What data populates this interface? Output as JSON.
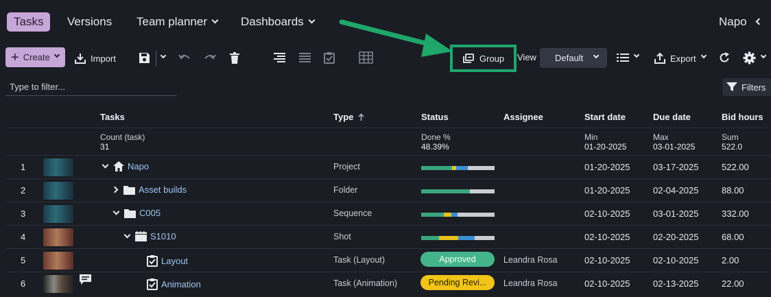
{
  "nav": {
    "tabs": [
      {
        "label": "Tasks"
      },
      {
        "label": "Versions"
      },
      {
        "label": "Team planner"
      },
      {
        "label": "Dashboards"
      }
    ],
    "project": "Napo"
  },
  "toolbar": {
    "create_label": "Create",
    "import_label": "Import",
    "group_label": "Group",
    "view_label": "View",
    "view_value": "Default",
    "export_label": "Export"
  },
  "filter": {
    "placeholder": "Type to filter...",
    "filters_label": "Filters"
  },
  "table": {
    "headers": {
      "tasks": "Tasks",
      "type": "Type",
      "status": "Status",
      "assignee": "Assignee",
      "start": "Start date",
      "due": "Due date",
      "bid": "Bid hours"
    },
    "aggregates": {
      "tasks_label": "Count (task)",
      "tasks_value": "31",
      "status_label": "Done %",
      "status_value": "48.39%",
      "start_label": "Min",
      "start_value": "01-20-2025",
      "due_label": "Max",
      "due_value": "03-01-2025",
      "bid_label": "Sum",
      "bid_value": "522.0"
    },
    "rows": [
      {
        "num": "1",
        "name": "Napo",
        "type": "Project",
        "start": "01-20-2025",
        "due": "03-17-2025",
        "bid": "522.00",
        "assignee": ""
      },
      {
        "num": "2",
        "name": "Asset builds",
        "type": "Folder",
        "start": "01-20-2025",
        "due": "02-04-2025",
        "bid": "88.00",
        "assignee": ""
      },
      {
        "num": "3",
        "name": "C005",
        "type": "Sequence",
        "start": "02-10-2025",
        "due": "03-01-2025",
        "bid": "332.00",
        "assignee": ""
      },
      {
        "num": "4",
        "name": "S1010",
        "type": "Shot",
        "start": "02-10-2025",
        "due": "02-20-2025",
        "bid": "68.00",
        "assignee": ""
      },
      {
        "num": "5",
        "name": "Layout",
        "type": "Task (Layout)",
        "status": "Approved",
        "assignee": "Leandra Rosa",
        "start": "02-10-2025",
        "due": "02-10-2025",
        "bid": "2.00"
      },
      {
        "num": "6",
        "name": "Animation",
        "type": "Task (Animation)",
        "status": "Pending Revi...",
        "assignee": "Leandra Rosa",
        "start": "02-10-2025",
        "due": "02-13-2025",
        "bid": "22.00"
      }
    ]
  },
  "colors": {
    "accent": "#c7a6d8",
    "highlight": "#1fa66b",
    "approved": "#44b58b",
    "pending": "#f0c419",
    "bar_green": "#3aa57e",
    "bar_yellow": "#e9c21c",
    "bar_blue": "#3b8fd4",
    "bar_gray": "#c9ccd2"
  }
}
